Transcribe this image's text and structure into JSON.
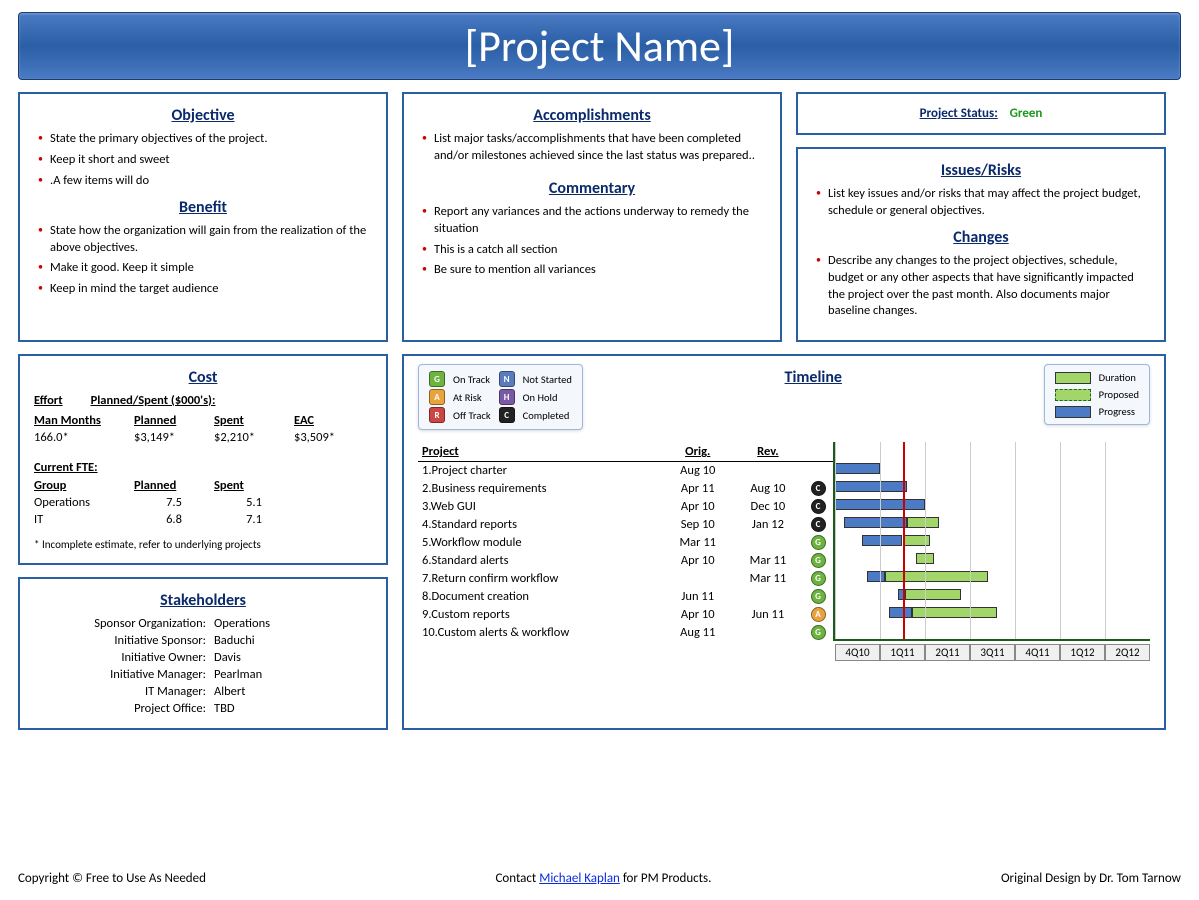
{
  "title": "[Project Name]",
  "objective": {
    "heading": "Objective",
    "items": [
      "State the primary objectives of the project.",
      "Keep it short and sweet",
      ".A few items will do"
    ]
  },
  "benefit": {
    "heading": "Benefit",
    "items": [
      "State how the organization will gain from the realization of the above objectives.",
      "Make it good. Keep it simple",
      "Keep in mind the target audience"
    ]
  },
  "accomplishments": {
    "heading": "Accomplishments",
    "items": [
      "List major tasks/accomplishments that have been completed and/or milestones achieved since the last status was prepared.."
    ]
  },
  "commentary": {
    "heading": "Commentary",
    "items": [
      "Report any variances and the actions underway to remedy the situation",
      "This is a catch all section",
      "Be sure to mention all variances"
    ]
  },
  "status": {
    "label": "Project Status:",
    "value": "Green",
    "color": "#1a9a1a"
  },
  "issues": {
    "heading": "Issues/Risks",
    "items": [
      "List key issues and/or risks that may affect the project budget, schedule or general objectives."
    ]
  },
  "changes": {
    "heading": "Changes",
    "items": [
      "Describe any changes to the project objectives, schedule, budget or any other aspects that have significantly impacted the project over the past month. Also documents major baseline changes."
    ]
  },
  "cost": {
    "heading": "Cost",
    "effort_label": "Effort",
    "planned_spent_label": "Planned/Spent ($000's):",
    "columns": [
      "Man Months",
      "Planned",
      "Spent",
      "EAC"
    ],
    "values": [
      "166.0*",
      "$3,149*",
      "$2,210*",
      "$3,509*"
    ],
    "fte_label": "Current FTE:",
    "fte_header": [
      "Group",
      "Planned",
      "Spent"
    ],
    "fte_rows": [
      {
        "group": "Operations",
        "planned": "7.5",
        "spent": "5.1"
      },
      {
        "group": "IT",
        "planned": "6.8",
        "spent": "7.1"
      }
    ],
    "note": "* Incomplete estimate, refer to underlying projects"
  },
  "stakeholders": {
    "heading": "Stakeholders",
    "rows": [
      {
        "label": "Sponsor Organization:",
        "value": "Operations"
      },
      {
        "label": "Initiative Sponsor:",
        "value": "Baduchi"
      },
      {
        "label": "Initiative Owner:",
        "value": "Davis"
      },
      {
        "label": "Initiative Manager:",
        "value": "Pearlman"
      },
      {
        "label": "IT Manager:",
        "value": "Albert"
      },
      {
        "label": "Project Office:",
        "value": "TBD"
      }
    ]
  },
  "timeline": {
    "heading": "Timeline",
    "status_legend": [
      {
        "code": "G",
        "label": "On Track"
      },
      {
        "code": "N",
        "label": "Not Started"
      },
      {
        "code": "A",
        "label": "At Risk"
      },
      {
        "code": "H",
        "label": "On Hold"
      },
      {
        "code": "R",
        "label": "Off Track"
      },
      {
        "code": "C",
        "label": "Completed"
      }
    ],
    "bar_legend": [
      {
        "type": "dur",
        "label": "Duration"
      },
      {
        "type": "prop",
        "label": "Proposed"
      },
      {
        "type": "prog",
        "label": "Progress"
      }
    ],
    "columns": [
      "Project",
      "Orig.",
      "Rev."
    ],
    "rows": [
      {
        "n": "1",
        "name": "Project charter",
        "orig": "Aug 10",
        "rev": "",
        "status": ""
      },
      {
        "n": "2",
        "name": "Business requirements",
        "orig": "Apr 11",
        "rev": "Aug 10",
        "status": "C"
      },
      {
        "n": "3",
        "name": "Web GUI",
        "orig": "Apr 10",
        "rev": "Dec 10",
        "status": "C"
      },
      {
        "n": "4",
        "name": "Standard reports",
        "orig": "Sep 10",
        "rev": "Jan 12",
        "status": "C"
      },
      {
        "n": "5",
        "name": "Workflow module",
        "orig": "Mar 11",
        "rev": "",
        "status": "G"
      },
      {
        "n": "6",
        "name": "Standard alerts",
        "orig": "Apr 10",
        "rev": "Mar 11",
        "status": "G"
      },
      {
        "n": "7",
        "name": "Return confirm workflow",
        "orig": "",
        "rev": "Mar 11",
        "status": "G"
      },
      {
        "n": "8",
        "name": "Document creation",
        "orig": "Jun 11",
        "rev": "",
        "status": "G"
      },
      {
        "n": "9",
        "name": "Custom reports",
        "orig": "Apr 10",
        "rev": "Jun 11",
        "status": "A"
      },
      {
        "n": "10",
        "name": "Custom alerts & workflow",
        "orig": "Aug 11",
        "rev": "",
        "status": "G"
      }
    ],
    "axis": [
      "4Q10",
      "1Q11",
      "2Q11",
      "3Q11",
      "4Q11",
      "1Q12",
      "2Q12"
    ]
  },
  "chart_data": {
    "type": "bar",
    "x_categories": [
      "4Q10",
      "1Q11",
      "2Q11",
      "3Q11",
      "4Q11",
      "1Q12",
      "2Q12"
    ],
    "today_line_position": "mid 1Q11",
    "series_description": "Gantt rows with progress (blue) and duration (green) bar segments. start/end expressed as fractional quarter index (0 = start of 4Q10, 7 = end of 2Q12).",
    "bars": [
      {
        "row": 2,
        "type": "progress",
        "start": 0.0,
        "end": 1.0
      },
      {
        "row": 3,
        "type": "progress",
        "start": 0.0,
        "end": 1.6
      },
      {
        "row": 4,
        "type": "progress",
        "start": 0.0,
        "end": 2.0
      },
      {
        "row": 5,
        "type": "progress",
        "start": 0.2,
        "end": 1.6
      },
      {
        "row": 5,
        "type": "duration",
        "start": 1.6,
        "end": 2.3
      },
      {
        "row": 6,
        "type": "progress",
        "start": 0.6,
        "end": 1.5
      },
      {
        "row": 6,
        "type": "duration",
        "start": 1.5,
        "end": 2.1
      },
      {
        "row": 7,
        "type": "duration",
        "start": 1.8,
        "end": 2.2
      },
      {
        "row": 8,
        "type": "progress",
        "start": 0.7,
        "end": 1.1
      },
      {
        "row": 8,
        "type": "duration",
        "start": 1.1,
        "end": 3.4
      },
      {
        "row": 9,
        "type": "progress",
        "start": 1.4,
        "end": 1.55
      },
      {
        "row": 9,
        "type": "duration",
        "start": 1.55,
        "end": 2.8
      },
      {
        "row": 10,
        "type": "progress",
        "start": 1.2,
        "end": 1.7
      },
      {
        "row": 10,
        "type": "duration",
        "start": 1.7,
        "end": 3.6
      }
    ]
  },
  "footer": {
    "left": "Copyright © Free to Use As Needed",
    "mid_pre": "Contact ",
    "mid_link": "Michael Kaplan",
    "mid_post": " for PM Products.",
    "right": "Original Design by Dr. Tom Tarnow"
  }
}
